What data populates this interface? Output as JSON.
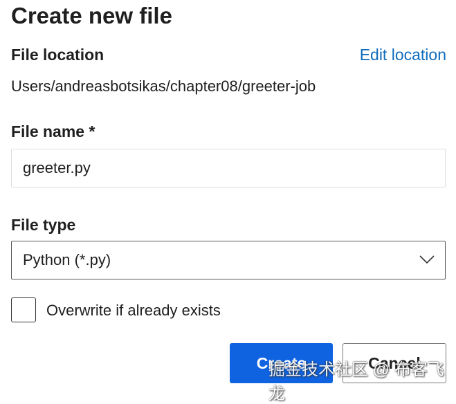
{
  "dialog": {
    "title": "Create new file",
    "file_location_label": "File location",
    "edit_location": "Edit location",
    "location_path": "Users/andreasbotsikas/chapter08/greeter-job",
    "file_name_label": "File name *",
    "file_name_value": "greeter.py",
    "file_type_label": "File type",
    "file_type_value": "Python (*.py)",
    "overwrite_label": "Overwrite if already exists",
    "overwrite_checked": false,
    "create_label": "Create",
    "cancel_label": "Cancel"
  },
  "watermark": "掘金技术社区 @ 布客飞龙",
  "colors": {
    "accent": "#0f62e0",
    "link": "#0f6cbd"
  }
}
